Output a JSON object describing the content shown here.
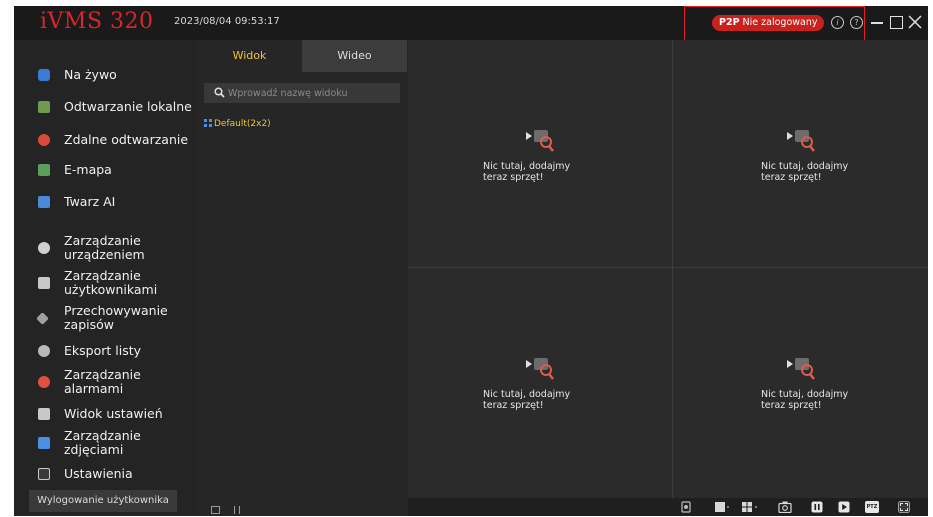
{
  "app": {
    "logo": "iVMS 320",
    "datetime": "2023/08/04 09:53:17",
    "p2p_badge": "P2P",
    "login_status": "Nie zalogowany",
    "accent_color": "#d7262e",
    "active_tab_color": "#f0c23b"
  },
  "titlebar_icons": [
    "info-icon",
    "help-icon",
    "minimize-icon",
    "maximize-icon",
    "close-icon"
  ],
  "sidebar": {
    "items": [
      {
        "label": "Na żywo",
        "icon": "live-view-icon"
      },
      {
        "label": "Odtwarzanie lokalne",
        "icon": "local-playback-icon"
      },
      {
        "label": "Zdalne odtwarzanie",
        "icon": "remote-playback-icon"
      },
      {
        "label": "E-mapa",
        "icon": "emap-icon"
      },
      {
        "label": "Twarz AI",
        "icon": "face-ai-icon"
      },
      {
        "label": "Zarządzanie\nurządzeniem",
        "icon": "device-management-icon"
      },
      {
        "label": "Zarządzanie\nużytkownikami",
        "icon": "user-management-icon"
      },
      {
        "label": "Przechowywanie\nzapisów",
        "icon": "storage-icon"
      },
      {
        "label": "Eksport listy",
        "icon": "export-icon"
      },
      {
        "label": "Zarządzanie\nalarmami",
        "icon": "alarm-icon"
      },
      {
        "label": "Widok ustawień",
        "icon": "view-settings-icon"
      },
      {
        "label": "Zarządzanie\nzdjęciami",
        "icon": "picture-management-icon"
      },
      {
        "label": "Ustawienia",
        "icon": "settings-icon"
      }
    ],
    "logout": "Wylogowanie użytkownika"
  },
  "view_panel": {
    "tabs": [
      "Widok",
      "Wideo"
    ],
    "active_tab": "Widok",
    "search_placeholder": "Wprowadź nazwę widoku",
    "tree_item": "Default(2x2)"
  },
  "grid": {
    "cells": [
      {
        "empty_text": "Nic tutaj, dodajmy\nteraz sprzęt!"
      },
      {
        "empty_text": "Nic tutaj, dodajmy\nteraz sprzęt!"
      },
      {
        "empty_text": "Nic tutaj, dodajmy\nteraz sprzęt!"
      },
      {
        "empty_text": "Nic tutaj, dodajmy\nteraz sprzęt!"
      }
    ]
  },
  "toolbar": {
    "tools": [
      "stop-all-icon",
      "single-screen-icon",
      "quad-screen-icon",
      "snapshot-icon",
      "pause-icon",
      "play-icon",
      "ptz-icon",
      "fullscreen-icon"
    ],
    "ptz_label": "PTZ"
  }
}
